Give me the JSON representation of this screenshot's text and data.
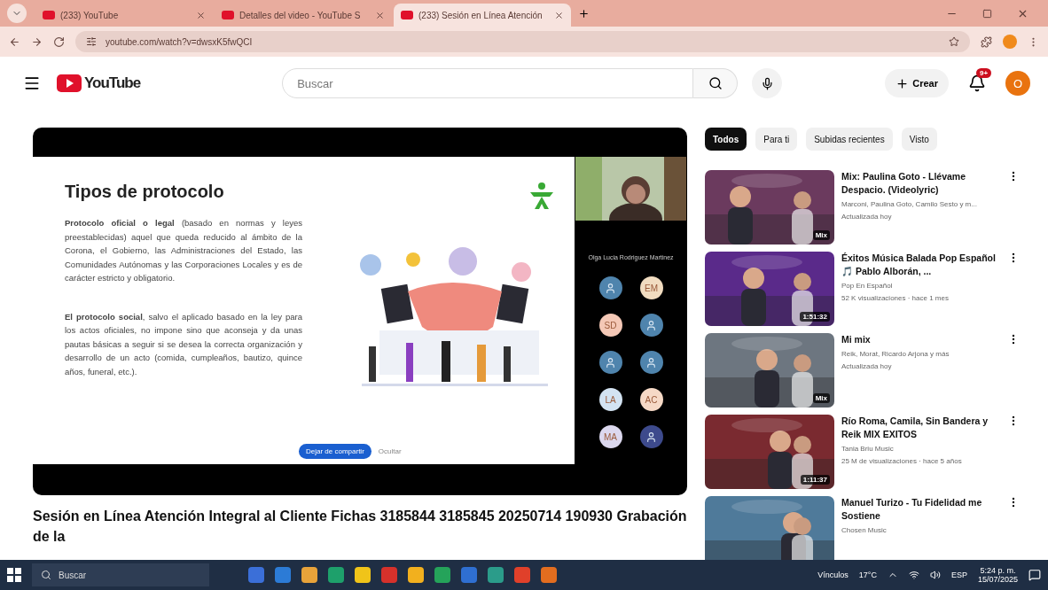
{
  "browser": {
    "tabs": [
      {
        "title": "(233) YouTube",
        "selected": false
      },
      {
        "title": "Detalles del video - YouTube S",
        "selected": false
      },
      {
        "title": "(233) Sesión en Línea Atención",
        "selected": true
      }
    ],
    "url": "youtube.com/watch?v=dwsxK5fwQCI"
  },
  "header": {
    "logo": "YouTube",
    "search": {
      "placeholder": "Buscar"
    },
    "create": "Crear",
    "notifications": "9+",
    "avatar": "O"
  },
  "player": {
    "slide": {
      "title": "Tipos de  protocolo",
      "paragraphs": [
        "**Protocolo oficial o legal** (basado en normas y leyes preestablecidas) aquel que queda reducido al ámbito de la Corona, el Gobierno, las Administraciones del Estado, las Comunidades Autónomas y las Corporaciones Locales y es de carácter estricto y obligatorio.",
        "**El protocolo social**, salvo el aplicado basado en la ley para los actos oficiales, no impone sino que aconseja y da unas pautas básicas a seguir si se desea la correcta organización y desarrollo de un acto (comida, cumpleaños, bautizo, quince años, funeral, etc.)."
      ]
    },
    "share_bar": {
      "button": "Dejar de compartir",
      "hide": "Ocultar"
    },
    "presenter": "Olga Lucia Rodriguez Martinez",
    "participants": [
      {
        "kind": "icon",
        "color": "#4f84ad"
      },
      {
        "kind": "initials",
        "initials": "EM",
        "color": "#f1dcc0"
      },
      {
        "kind": "initials",
        "initials": "SD",
        "color": "#f4c8b6"
      },
      {
        "kind": "icon",
        "color": "#4f84ad"
      },
      {
        "kind": "icon",
        "color": "#4f84ad"
      },
      {
        "kind": "icon",
        "color": "#4f84ad"
      },
      {
        "kind": "initials",
        "initials": "LA",
        "color": "#d3e3f2"
      },
      {
        "kind": "initials",
        "initials": "AC",
        "color": "#f6d9c6"
      },
      {
        "kind": "initials",
        "initials": "MA",
        "color": "#dcd8ee"
      },
      {
        "kind": "icon",
        "color": "#3d4a8c"
      }
    ]
  },
  "video_title": "Sesión en Línea Atención Integral al Cliente Fichas 3185844 3185845 20250714 190930 Grabación de la",
  "chips": [
    {
      "label": "Todos",
      "selected": true
    },
    {
      "label": "Para ti",
      "selected": false
    },
    {
      "label": "Subidas recientes",
      "selected": false
    },
    {
      "label": "Visto",
      "selected": false
    }
  ],
  "recommendations": [
    {
      "title": "Mix: Paulina Goto - Llévame Despacio. (Videolyric)",
      "channel": "Marconi, Paulina Goto, Camilo Sesto y m...",
      "meta": "Actualizada hoy",
      "badge": "Mix"
    },
    {
      "title": "Éxitos Música Balada Pop Español 🎵 Pablo Alborán, ...",
      "channel": "Pop En Español",
      "meta": "52 K visualizaciones · hace 1 mes",
      "badge": "1:51:32"
    },
    {
      "title": "Mi mix",
      "channel": "Reik, Morat, Ricardo Arjona y más",
      "meta": "Actualizada hoy",
      "badge": "Mix"
    },
    {
      "title": "Río Roma, Camila, Sin Bandera y Reik MIX EXITOS",
      "channel": "Tania Briu Music",
      "meta": "25 M de visualizaciones · hace 5 años",
      "badge": "1:11:37"
    },
    {
      "title": "Manuel Turizo - Tu Fidelidad me Sostiene",
      "channel": "Chosen Music"
    }
  ],
  "taskbar": {
    "search": {
      "placeholder": "Buscar"
    },
    "links": "Vínculos",
    "weather": "17°C",
    "language": "ESP",
    "time": "5:24 p. m.",
    "date": "15/07/2025"
  }
}
